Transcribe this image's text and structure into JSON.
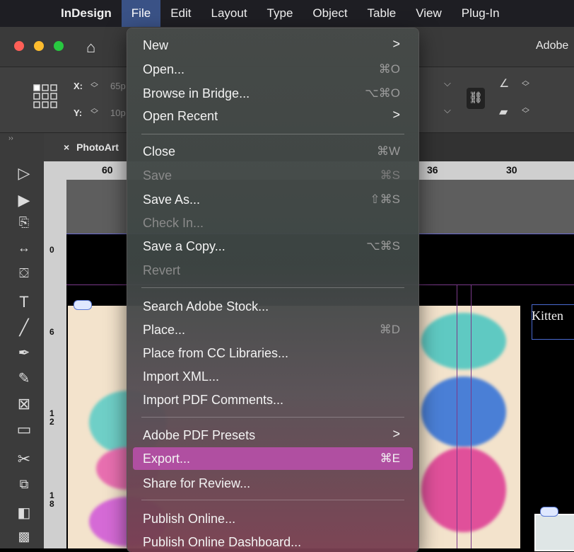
{
  "menubar": {
    "apple": "",
    "items": [
      "InDesign",
      "File",
      "Edit",
      "Layout",
      "Type",
      "Object",
      "Table",
      "View",
      "Plug-In"
    ]
  },
  "titlebar": {
    "title": "Adobe"
  },
  "control": {
    "x_label": "X:",
    "x_value": "65p",
    "y_label": "Y:",
    "y_value": "10p"
  },
  "document_tab": {
    "close": "×",
    "name": "PhotoArt"
  },
  "ruler": {
    "h_numbers": [
      "60",
      "36",
      "30"
    ],
    "v_numbers": [
      "0",
      "6",
      "1\n2",
      "1\n8"
    ]
  },
  "canvas": {
    "text_frame": "Kitten"
  },
  "file_menu": {
    "items": [
      {
        "label": "New",
        "shortcut": "",
        "submenu": true,
        "enabled": true
      },
      {
        "label": "Open...",
        "shortcut": "⌘O",
        "submenu": false,
        "enabled": true
      },
      {
        "label": "Browse in Bridge...",
        "shortcut": "⌥⌘O",
        "submenu": false,
        "enabled": true
      },
      {
        "label": "Open Recent",
        "shortcut": "",
        "submenu": true,
        "enabled": true
      },
      {
        "label": "Close",
        "shortcut": "⌘W",
        "submenu": false,
        "enabled": true
      },
      {
        "label": "Save",
        "shortcut": "⌘S",
        "submenu": false,
        "enabled": false
      },
      {
        "label": "Save As...",
        "shortcut": "⇧⌘S",
        "submenu": false,
        "enabled": true
      },
      {
        "label": "Check In...",
        "shortcut": "",
        "submenu": false,
        "enabled": false
      },
      {
        "label": "Save a Copy...",
        "shortcut": "⌥⌘S",
        "submenu": false,
        "enabled": true
      },
      {
        "label": "Revert",
        "shortcut": "",
        "submenu": false,
        "enabled": false
      },
      {
        "label": "Search Adobe Stock...",
        "shortcut": "",
        "submenu": false,
        "enabled": true
      },
      {
        "label": "Place...",
        "shortcut": "⌘D",
        "submenu": false,
        "enabled": true
      },
      {
        "label": "Place from CC Libraries...",
        "shortcut": "",
        "submenu": false,
        "enabled": true
      },
      {
        "label": "Import XML...",
        "shortcut": "",
        "submenu": false,
        "enabled": true
      },
      {
        "label": "Import PDF Comments...",
        "shortcut": "",
        "submenu": false,
        "enabled": true
      },
      {
        "label": "Adobe PDF Presets",
        "shortcut": "",
        "submenu": true,
        "enabled": true
      },
      {
        "label": "Export...",
        "shortcut": "⌘E",
        "submenu": false,
        "enabled": true,
        "highlighted": true
      },
      {
        "label": "Share for Review...",
        "shortcut": "",
        "submenu": false,
        "enabled": true
      },
      {
        "label": "Publish Online...",
        "shortcut": "",
        "submenu": false,
        "enabled": true
      },
      {
        "label": "Publish Online Dashboard...",
        "shortcut": "",
        "submenu": false,
        "enabled": true
      }
    ],
    "submenu_arrow": ">"
  },
  "colors": {
    "menu_highlight": "#b04fa1",
    "traffic_red": "#ff5f57",
    "traffic_yellow": "#febc2e",
    "traffic_green": "#28c840",
    "menubar_active": "#3a5286"
  }
}
